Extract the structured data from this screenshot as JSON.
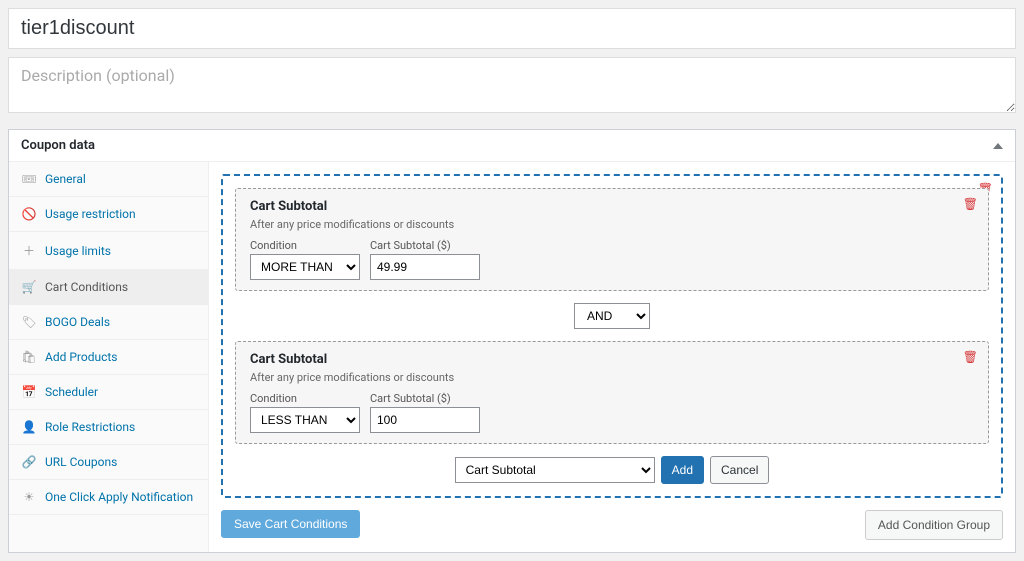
{
  "title_value": "tier1discount",
  "description_placeholder": "Description (optional)",
  "panel_title": "Coupon data",
  "tabs": [
    {
      "label": "General"
    },
    {
      "label": "Usage restriction"
    },
    {
      "label": "Usage limits"
    },
    {
      "label": "Cart Conditions"
    },
    {
      "label": "BOGO Deals"
    },
    {
      "label": "Add Products"
    },
    {
      "label": "Scheduler"
    },
    {
      "label": "Role Restrictions"
    },
    {
      "label": "URL Coupons"
    },
    {
      "label": "One Click Apply Notification"
    }
  ],
  "condition1": {
    "title": "Cart Subtotal",
    "subtitle": "After any price modifications or discounts",
    "cond_label": "Condition",
    "cond_value": "MORE THAN",
    "amt_label": "Cart Subtotal ($)",
    "amt_value": "49.99"
  },
  "logic_value": "AND",
  "condition2": {
    "title": "Cart Subtotal",
    "subtitle": "After any price modifications or discounts",
    "cond_label": "Condition",
    "cond_value": "LESS THAN",
    "amt_label": "Cart Subtotal ($)",
    "amt_value": "100"
  },
  "add_type_value": "Cart Subtotal",
  "add_btn": "Add",
  "cancel_btn": "Cancel",
  "save_btn": "Save Cart Conditions",
  "add_group_btn": "Add Condition Group"
}
